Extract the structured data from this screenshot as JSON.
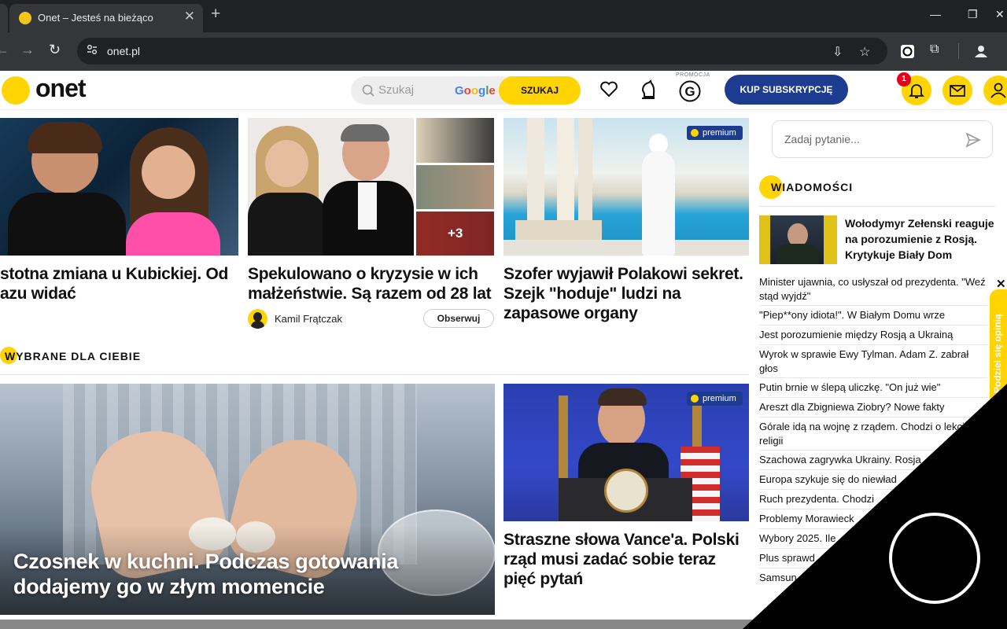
{
  "browser": {
    "tab_title": "Onet – Jesteś na bieżąco",
    "url": "onet.pl"
  },
  "colors": {
    "brand_yellow": "#ffd400",
    "subscribe_blue": "#1d3c8f",
    "badge_red": "#e2001a"
  },
  "header": {
    "logo": "onet",
    "search_placeholder": "Szukaj",
    "search_provider": "Google",
    "search_button": "SZUKAJ",
    "promo_label": "PROMOCJA",
    "subscribe_button": "KUP SUBSKRYPCJĘ",
    "notification_count": "1"
  },
  "top_articles": [
    {
      "headline": "stotna zmiana u Kubickiej. Od azu widać"
    },
    {
      "headline": "Spekulowano o kryzysie w ich małżeństwie. Są razem od 28 lat",
      "gallery_more": "+3",
      "author": "Kamil Frątczak",
      "follow_button": "Obserwuj"
    },
    {
      "headline": "Szofer wyjawił Polakowi sekret. Szejk \"hoduje\" ludzi na zapasowe organy",
      "badge": "premium"
    }
  ],
  "section_for_you": {
    "title": "WYBRANE DLA CIEBIE"
  },
  "for_you_articles": [
    {
      "headline": "Czosnek w kuchni. Podczas gotowania dodajemy go w złym momencie"
    },
    {
      "headline": "Straszne słowa Vance'a. Polski rząd musi zadać sobie teraz pięć pytań",
      "badge": "premium"
    }
  ],
  "sidebar": {
    "ask_placeholder": "Zadaj pytanie...",
    "news_title": "WIADOMOŚCI",
    "lead_headline": "Wołodymyr Zełenski reaguje na porozumienie z Rosją. Krytykuje Biały Dom",
    "news": [
      "Minister ujawnia, co usłyszał od prezydenta. \"Weź stąd wyjdź\"",
      "\"Piep**ony idiota!\". W Białym Domu wrze",
      "Jest porozumienie między Rosją a Ukrainą",
      "Wyrok w sprawie Ewy Tylman. Adam Z. zabrał głos",
      "Putin brnie w ślepą uliczkę. \"On już wie\"",
      "Areszt dla Zbigniewa Ziobry? Nowe fakty",
      "Górale idą na wojnę z rządem. Chodzi o lekcje religii",
      "Szachowa zagrywka Ukrainy. Rosja",
      "Europa szykuje się do niewład",
      "Ruch prezydenta. Chodzi",
      "Problemy Morawieck",
      "Wybory 2025. Ile",
      "Plus sprawd",
      "Samsun"
    ],
    "feedback_label": "Podziel się opinią"
  }
}
